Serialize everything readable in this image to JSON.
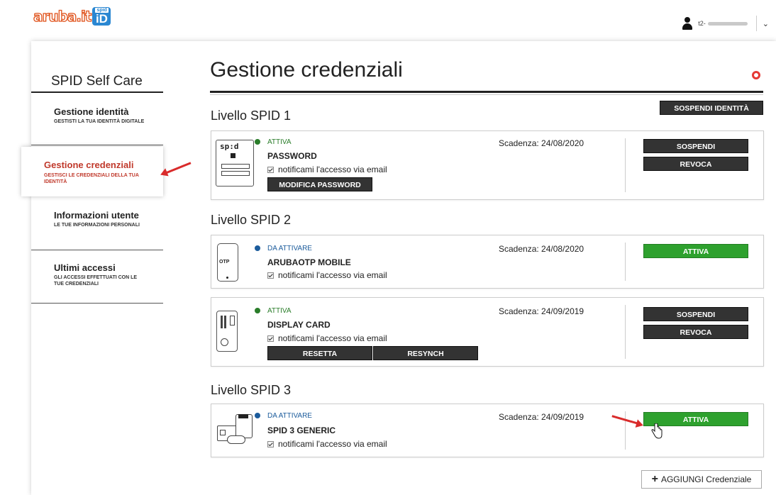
{
  "header": {
    "logo_text": "aruba.it",
    "logo_badge_small": "spid",
    "logo_badge_big": "iD",
    "user_prefix": "t2-",
    "user_caret": "⌄"
  },
  "sidebar": {
    "title": "SPID Self Care",
    "items": [
      {
        "title": "Gestione identità",
        "subtitle": "GESTISTI LA TUA IDENTITÀ DIGITALE"
      },
      {
        "title": "Gestione credenziali",
        "subtitle": "GESTISCI LE CREDENZIALI DELLA TUA IDENTITÀ"
      },
      {
        "title": "Informazioni utente",
        "subtitle": "LE TUE INFORMAZIONI PERSONALI"
      },
      {
        "title": "Ultimi accessi",
        "subtitle": "GLI ACCESSI EFFETTUATI CON LE TUE CREDENZIALI"
      }
    ]
  },
  "main": {
    "title": "Gestione credenziali",
    "suspend_identity_label": "SOSPENDI IDENTITÀ",
    "levels": [
      "Livello SPID 1",
      "Livello SPID 2",
      "Livello SPID 3"
    ],
    "cards": [
      {
        "status": "ATTIVA",
        "name": "PASSWORD",
        "notify": "notificami l'accesso via email",
        "expiry": "Scadenza: 24/08/2020",
        "extra_buttons": [
          "MODIFICA PASSWORD"
        ],
        "actions": [
          "SOSPENDI",
          "REVOCA"
        ],
        "icon_text": "sp:d"
      },
      {
        "status": "DA ATTIVARE",
        "name": "ARUBAOTP MOBILE",
        "notify": "notificami l'accesso via email",
        "expiry": "Scadenza: 24/08/2020",
        "actions": [
          "ATTIVA"
        ],
        "icon_text": "OTP"
      },
      {
        "status": "ATTIVA",
        "name": "DISPLAY CARD",
        "notify": "notificami l'accesso via email",
        "expiry": "Scadenza: 24/09/2019",
        "extra_buttons": [
          "RESETTA",
          "RESYNCH"
        ],
        "actions": [
          "SOSPENDI",
          "REVOCA"
        ]
      },
      {
        "status": "DA ATTIVARE",
        "name": "SPID 3 GENERIC",
        "notify": "notificami l'accesso via email",
        "expiry": "Scadenza: 24/09/2019",
        "actions": [
          "ATTIVA"
        ]
      }
    ],
    "add_label": "AGGIUNGI Credenziale"
  },
  "colors": {
    "active_green": "#2ea12e",
    "status_active_dot": "#2a7d2a",
    "status_pending_dot": "#1c5c9c",
    "highlight_red": "#c0392b",
    "arrow_red": "#d92b2b"
  }
}
